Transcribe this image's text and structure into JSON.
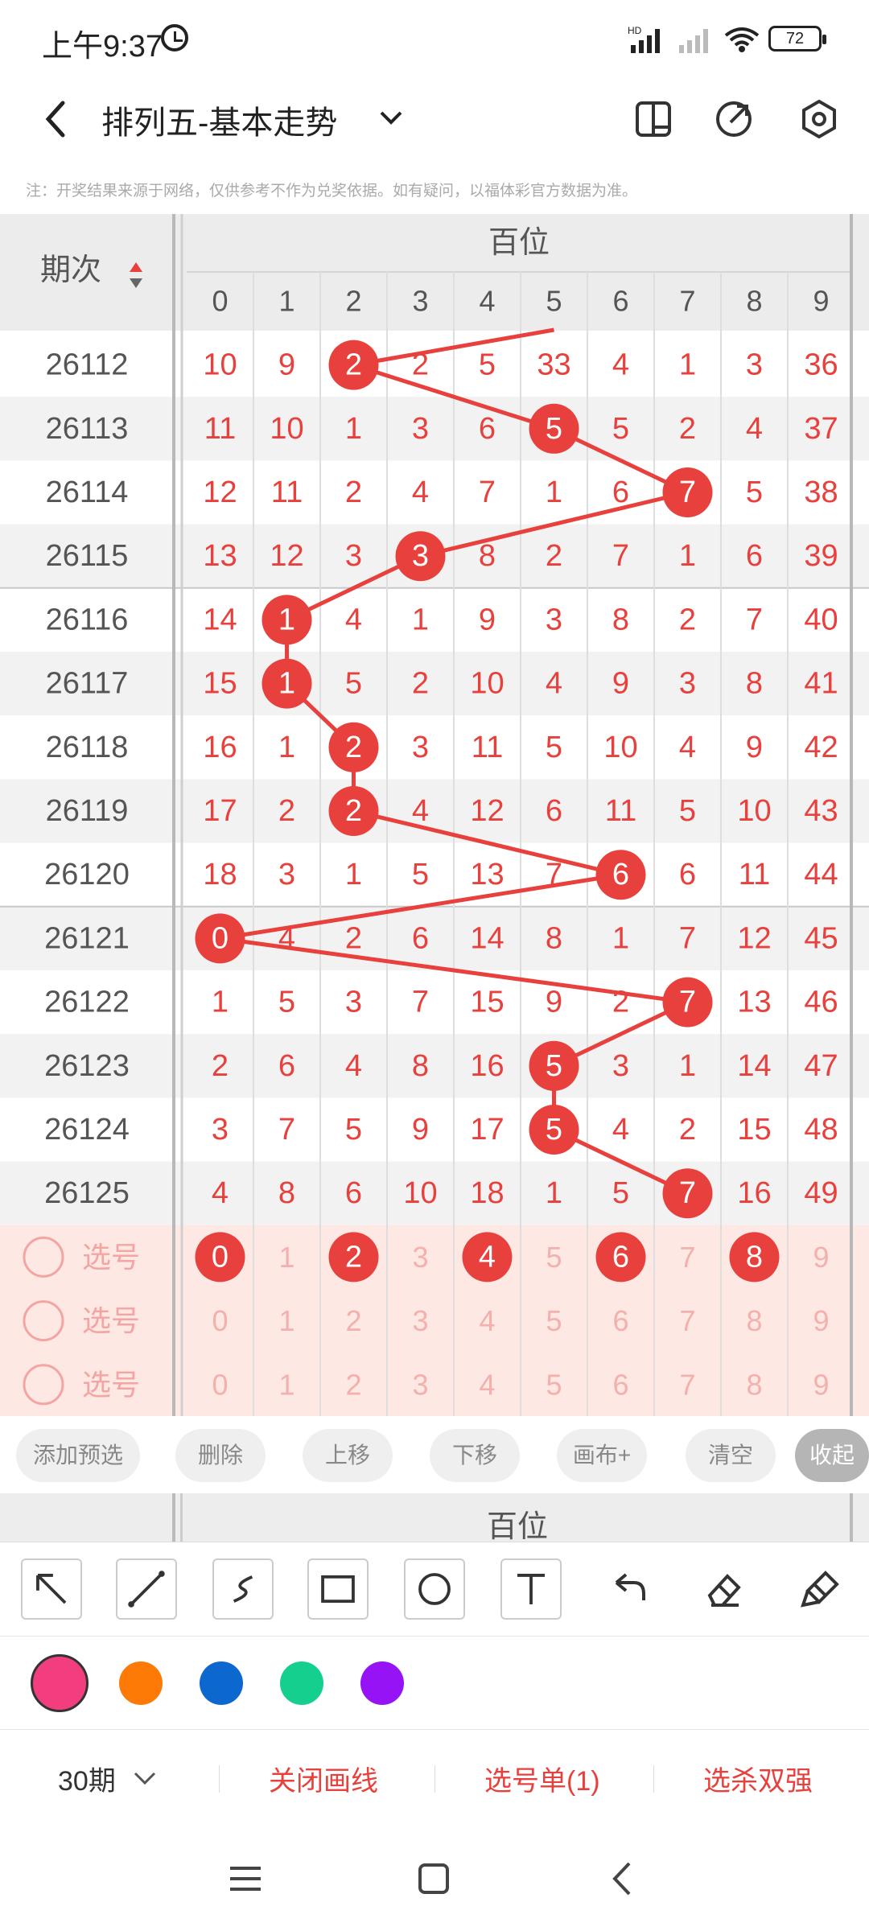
{
  "status": {
    "time": "上午9:37",
    "battery": "72"
  },
  "header": {
    "title": "排列五-基本走势"
  },
  "note": "注：开奖结果来源于网络，仅供参考不作为兑奖依据。如有疑问，以福体彩官方数据为准。",
  "table": {
    "period_header": "期次",
    "section_label": "百位",
    "columns": [
      "0",
      "1",
      "2",
      "3",
      "4",
      "5",
      "6",
      "7",
      "8",
      "9"
    ],
    "rows": [
      {
        "period": "26112",
        "cells": [
          "10",
          "9",
          "2",
          "2",
          "5",
          "33",
          "4",
          "1",
          "3",
          "36"
        ],
        "hit": 2
      },
      {
        "period": "26113",
        "cells": [
          "11",
          "10",
          "1",
          "3",
          "6",
          "5",
          "5",
          "2",
          "4",
          "37"
        ],
        "hit": 5
      },
      {
        "period": "26114",
        "cells": [
          "12",
          "11",
          "2",
          "4",
          "7",
          "1",
          "6",
          "7",
          "5",
          "38"
        ],
        "hit": 7
      },
      {
        "period": "26115",
        "cells": [
          "13",
          "12",
          "3",
          "3",
          "8",
          "2",
          "7",
          "1",
          "6",
          "39"
        ],
        "hit": 3
      },
      {
        "period": "26116",
        "cells": [
          "14",
          "1",
          "4",
          "1",
          "9",
          "3",
          "8",
          "2",
          "7",
          "40"
        ],
        "hit": 1
      },
      {
        "period": "26117",
        "cells": [
          "15",
          "1",
          "5",
          "2",
          "10",
          "4",
          "9",
          "3",
          "8",
          "41"
        ],
        "hit": 1
      },
      {
        "period": "26118",
        "cells": [
          "16",
          "1",
          "2",
          "3",
          "11",
          "5",
          "10",
          "4",
          "9",
          "42"
        ],
        "hit": 2
      },
      {
        "period": "26119",
        "cells": [
          "17",
          "2",
          "2",
          "4",
          "12",
          "6",
          "11",
          "5",
          "10",
          "43"
        ],
        "hit": 2
      },
      {
        "period": "26120",
        "cells": [
          "18",
          "3",
          "1",
          "5",
          "13",
          "7",
          "6",
          "6",
          "11",
          "44"
        ],
        "hit": 6
      },
      {
        "period": "26121",
        "cells": [
          "0",
          "4",
          "2",
          "6",
          "14",
          "8",
          "1",
          "7",
          "12",
          "45"
        ],
        "hit": 0
      },
      {
        "period": "26122",
        "cells": [
          "1",
          "5",
          "3",
          "7",
          "15",
          "9",
          "2",
          "7",
          "13",
          "46"
        ],
        "hit": 7
      },
      {
        "period": "26123",
        "cells": [
          "2",
          "6",
          "4",
          "8",
          "16",
          "5",
          "3",
          "1",
          "14",
          "47"
        ],
        "hit": 5
      },
      {
        "period": "26124",
        "cells": [
          "3",
          "7",
          "5",
          "9",
          "17",
          "5",
          "4",
          "2",
          "15",
          "48"
        ],
        "hit": 5
      },
      {
        "period": "26125",
        "cells": [
          "4",
          "8",
          "6",
          "10",
          "18",
          "1",
          "5",
          "7",
          "16",
          "49"
        ],
        "hit": 7
      }
    ],
    "select_rows": [
      {
        "label": "选号",
        "numbers": [
          "0",
          "1",
          "2",
          "3",
          "4",
          "5",
          "6",
          "7",
          "8",
          "9"
        ],
        "selected": [
          0,
          2,
          4,
          6,
          8
        ]
      },
      {
        "label": "选号",
        "numbers": [
          "0",
          "1",
          "2",
          "3",
          "4",
          "5",
          "6",
          "7",
          "8",
          "9"
        ],
        "selected": []
      },
      {
        "label": "选号",
        "numbers": [
          "0",
          "1",
          "2",
          "3",
          "4",
          "5",
          "6",
          "7",
          "8",
          "9"
        ],
        "selected": []
      }
    ]
  },
  "actions": [
    "添加预选",
    "删除",
    "上移",
    "下移",
    "画布+",
    "清空",
    "收起"
  ],
  "draw_tools": [
    "arrow-tool",
    "line-tool",
    "curve-tool",
    "rect-tool",
    "circle-tool",
    "text-tool",
    "undo",
    "eraser",
    "brush-clear"
  ],
  "colors": [
    "#f23d7e",
    "#fe7a07",
    "#0c67cf",
    "#15cf8f",
    "#9513f5"
  ],
  "bottom": {
    "period_select": "30期",
    "close_lines": "关闭画线",
    "pick_list": "选号单(1)",
    "kill_strong": "选杀双强"
  }
}
